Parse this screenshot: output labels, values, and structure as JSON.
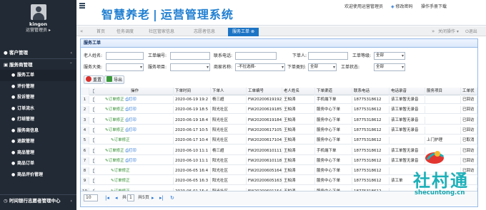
{
  "profile": {
    "name": "kingon",
    "role": "运营管理员 ▸"
  },
  "sidebar": {
    "top": {
      "label": "客户管理",
      "icon": "user-icon"
    },
    "section": {
      "label": "服务商管理",
      "icon": "building-icon"
    },
    "items": [
      {
        "label": "服务工单",
        "icon": "work-order-icon"
      },
      {
        "label": "评价管理",
        "icon": "rating-icon"
      },
      {
        "label": "投诉管理",
        "icon": "complaint-icon"
      },
      {
        "label": "订单流水",
        "icon": "order-flow-icon"
      },
      {
        "label": "打结管理",
        "icon": "tag-icon"
      },
      {
        "label": "服务商信息",
        "icon": "provider-info-icon"
      },
      {
        "label": "退款管理",
        "icon": "refund-icon"
      },
      {
        "label": "商品管理",
        "icon": "goods-icon"
      },
      {
        "label": "商品订单",
        "icon": "goods-order-icon"
      },
      {
        "label": "商品评价管理",
        "icon": "goods-rating-icon"
      }
    ],
    "bottom": {
      "label": "时间银行志愿者管理中心",
      "icon": "clock-icon"
    }
  },
  "header": {
    "title_left": "智慧养老",
    "title_sep": "|",
    "title_right": "运营管理系统",
    "welcome": "欢迎使用运营管理员",
    "change_password": "修改密码",
    "manual_download": "操作手册下载"
  },
  "tabs": {
    "items": [
      "首页",
      "任务调度",
      "社区管家信息",
      "志愿者信息",
      "服务工单"
    ],
    "active_index": 4,
    "close_action": "关闭操作",
    "exit": "退出"
  },
  "panel": {
    "title": "服务工单",
    "search": {
      "elder_name_label": "老人姓名:",
      "order_no_label": "工单编号:",
      "phone_label": "联系电话:",
      "receiver_label": "下单人:",
      "level_label": "工单等级:",
      "level_value": "全部",
      "category_label": "服务大类:",
      "item_label": "服务项目:",
      "provider_label": "商家名称:",
      "provider_value": "-不拉选择-",
      "source_label": "下单类别:",
      "source_value": "全部",
      "status_label": "工单状态:",
      "status_value": "全部"
    },
    "buttons": {
      "reset": "重置",
      "export": "导出"
    }
  },
  "grid": {
    "columns": [
      "",
      "操作",
      "下单时间",
      "下单人",
      "工单编号",
      "老人姓名",
      "下单渠道",
      "联系电话",
      "电话录音",
      "服务项目",
      "工单状"
    ],
    "rows": [
      {
        "n": "1",
        "edit": "订单修正",
        "print": "打印",
        "time": "2020-06-19 19:2",
        "by": "杨三超",
        "no": "FW20200619192",
        "elder": "王柏涛",
        "channel": "手机端下单",
        "phone": "18775318612",
        "rec": "该工单暂无录音",
        "item": "",
        "status": "已回访"
      },
      {
        "n": "2",
        "edit": "订单修正",
        "print": "打印",
        "time": "2020-06-19 18:5",
        "by": "阳光社区",
        "no": "FW20200619185",
        "elder": "王柏涛",
        "channel": "服务中心下单",
        "phone": "18775318612",
        "rec": "该工单暂无录音",
        "item": "",
        "status": "已回访"
      },
      {
        "n": "3",
        "edit": "订单修正",
        "print": "打印",
        "time": "2020-06-19 18:4",
        "by": "阳光社区",
        "no": "FW20200619184",
        "elder": "王柏涛",
        "channel": "服务中心下单",
        "phone": "18775318612",
        "rec": "该工单暂无录音",
        "item": "",
        "status": "已回访"
      },
      {
        "n": "4",
        "edit": "订单修正",
        "print": "打印",
        "time": "2020-06-17 10:5",
        "by": "阳光社区",
        "no": "FW20200617105",
        "elder": "王柏涛",
        "channel": "服务中心下单",
        "phone": "18775318612",
        "rec": "该工单暂无录音",
        "item": "",
        "status": "已回访"
      },
      {
        "n": "5",
        "edit": "订单修正",
        "print": "",
        "time": "2020-06-17 10:4",
        "by": "阳光社区",
        "no": "FW20200617104",
        "elder": "王柏涛",
        "channel": "服务中心下单",
        "phone": "18775318612",
        "rec": "",
        "item": "上门护理",
        "status": "已取消"
      },
      {
        "n": "6",
        "edit": "订单修正",
        "print": "打印",
        "time": "2020-06-10 11:1",
        "by": "杨三超",
        "no": "FW20200610111",
        "elder": "王柏涛",
        "channel": "手机端下单",
        "phone": "18775318612",
        "rec": "该工单暂无录音",
        "item": "",
        "status": "已回访"
      },
      {
        "n": "7",
        "edit": "订单修正",
        "print": "打印",
        "time": "2020-06-10 11:1",
        "by": "阳光社区",
        "no": "FW20200610118",
        "elder": "王柏涛",
        "channel": "服务中心下单",
        "phone": "18775318612",
        "rec": "该工单暂无录音",
        "item": "",
        "status": "已回访"
      },
      {
        "n": "8",
        "edit": "订单修正",
        "print": "",
        "time": "2020-06-05 16:4",
        "by": "阳光社区",
        "no": "FW20200605164",
        "elder": "王柏涛",
        "channel": "服务中心下单",
        "phone": "18775318612",
        "rec": "",
        "item": "",
        "status": "已回访"
      },
      {
        "n": "9",
        "edit": "订单修正",
        "print": "",
        "time": "2020-06-05 16:3",
        "by": "阳光社区",
        "no": "FW20200605163",
        "elder": "王柏涛",
        "channel": "服务中心下单",
        "phone": "18775318612",
        "rec": "该工单",
        "item": "",
        "status": ""
      },
      {
        "n": "10",
        "edit": "订单修正",
        "print": "",
        "time": "2020-06-01 15:4",
        "by": "阳光社区",
        "no": "FW20200601154",
        "elder": "王柏涛",
        "channel": "服务中心下单",
        "phone": "18775318612",
        "rec": "",
        "item": "",
        "status": ""
      }
    ]
  },
  "pager": {
    "page_size": "10",
    "page": "1",
    "total_prefix": "共",
    "total": "5",
    "total_suffix": "页"
  },
  "watermark": {
    "brand": "社村通",
    "url": "shecuntong.cn"
  }
}
